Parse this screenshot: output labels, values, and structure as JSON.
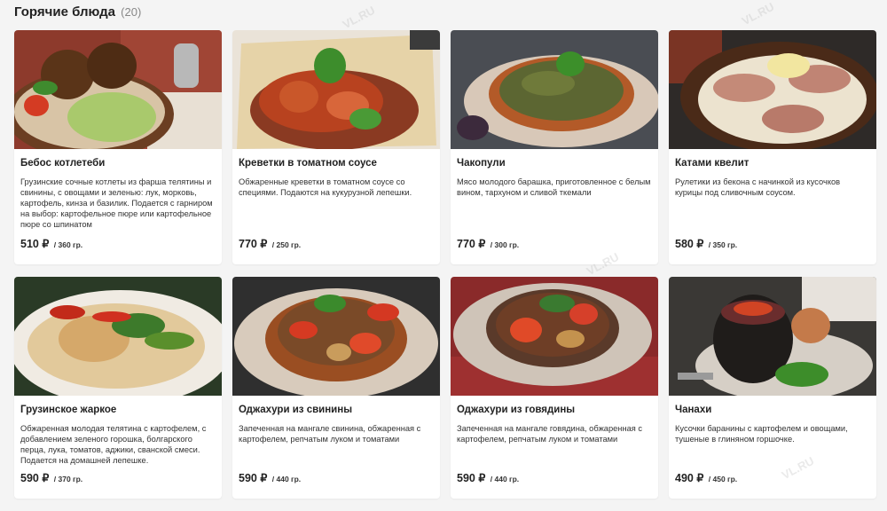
{
  "header": {
    "title": "Горячие блюда",
    "count": "(20)"
  },
  "watermark": "VL.RU",
  "dishes": [
    {
      "title": "Бебос котлетеби",
      "desc": "Грузинские сочные котлеты из фарша телятины и свинины, с овощами и зеленью: лук, морковь, картофель, кинза и базилик. Подается с гарниром на выбор: картофельное пюре или картофельное пюре со шпинатом",
      "price": "510 ₽",
      "weight": "/ 360 гр."
    },
    {
      "title": "Креветки в томатном соусе",
      "desc": "Обжаренные креветки в томатном соусе со специями. Подаются на кукурузной лепешки.",
      "price": "770 ₽",
      "weight": "/ 250 гр."
    },
    {
      "title": "Чакопули",
      "desc": "Мясо молодого барашка, приготовленное с белым вином, тархуном и сливой ткемали",
      "price": "770 ₽",
      "weight": "/ 300 гр."
    },
    {
      "title": "Катами квелит",
      "desc": "Рулетики из бекона с начинкой из кусочков курицы под сливочным соусом.",
      "price": "580 ₽",
      "weight": "/ 350 гр."
    },
    {
      "title": "Грузинское жаркое",
      "desc": "Обжаренная молодая телятина с картофелем, с добавлением зеленого горошка, болгарского перца, лука, томатов, аджики, сванской смеси. Подается на домашней лепешке.",
      "price": "590 ₽",
      "weight": "/ 370 гр."
    },
    {
      "title": "Оджахури из свинины",
      "desc": "Запеченная на мангале свинина, обжаренная с картофелем, репчатым луком и томатами",
      "price": "590 ₽",
      "weight": "/ 440 гр."
    },
    {
      "title": "Оджахури из говядины",
      "desc": "Запеченная на мангале говядина, обжаренная с картофелем, репчатым луком и томатами",
      "price": "590 ₽",
      "weight": "/ 440 гр."
    },
    {
      "title": "Чанахи",
      "desc": "Кусочки баранины с картофелем и овощами, тушеные в глиняном горшочке.",
      "price": "490 ₽",
      "weight": "/ 450 гр."
    }
  ]
}
